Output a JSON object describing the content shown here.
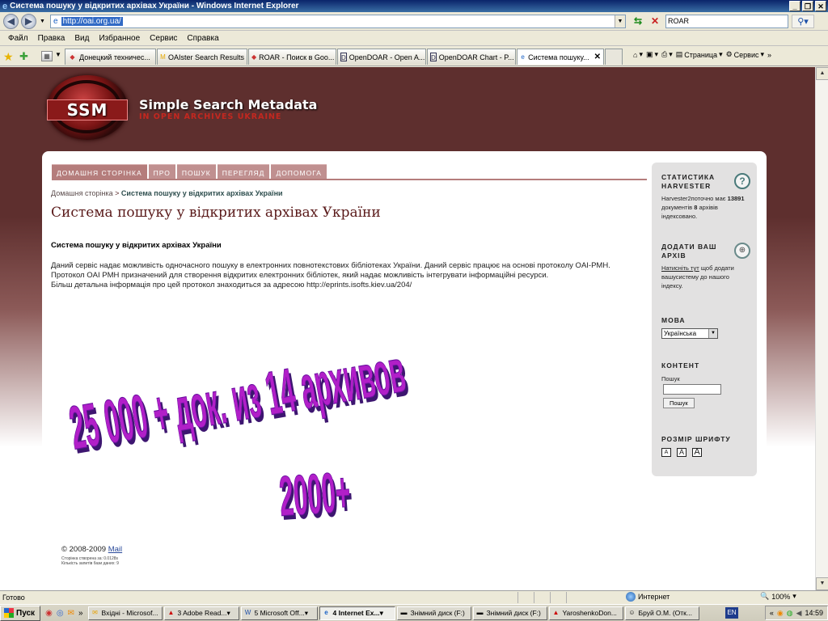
{
  "window": {
    "title": "Система пошуку у відкритих архівах України - Windows Internet Explorer",
    "minimize": "_",
    "maximize": "❐",
    "close": "✕"
  },
  "address": {
    "url": "http://oai.org.ua/",
    "search_value": "ROAR"
  },
  "menu": [
    "Файл",
    "Правка",
    "Вид",
    "Избранное",
    "Сервис",
    "Справка"
  ],
  "tabs": [
    {
      "label": "Донецкий техничес...",
      "icon": "roar-icon"
    },
    {
      "label": "OAIster Search Results",
      "icon": "oaister-icon"
    },
    {
      "label": "ROAR - Поиск в Goo...",
      "icon": "roar-icon"
    },
    {
      "label": "OpenDOAR - Open A...",
      "icon": "opendoar-icon"
    },
    {
      "label": "OpenDOAR Chart - P...",
      "icon": "opendoar-icon"
    },
    {
      "label": "Система пошуку...",
      "icon": "ie-icon",
      "active": true
    }
  ],
  "command_bar": {
    "page_label": "Страница",
    "tools_label": "Сервис"
  },
  "site": {
    "logo_text": "SSM",
    "title": "Simple Search Metadata",
    "subtitle": "IN OPEN ARCHIVES UKRAINE",
    "nav": [
      "ДОМАШНЯ СТОРІНКА",
      "ПРО",
      "ПОШУК",
      "ПЕРЕГЛЯД",
      "ДОПОМОГА"
    ],
    "breadcrumb_home": "Домашня сторінка",
    "breadcrumb_sep": ">",
    "breadcrumb_current": "Система пошуку у відкритих архівах України",
    "heading": "Система пошуку у відкритих архівах України",
    "section_title": "Система пошуку у відкритих архівах України",
    "paragraph": "Даний сервіс надає можливість одночасного пошуку в електронних повнотекстових бібліотеках України. Даний сервіс працює на основі протоколу OAI-PMH. Протокол OAI PMH призначений для створення відкритих електронних бібліотек, який надає можливість інтегрувати інформаційні ресурси.",
    "paragraph2": "Більш детальна інформація про цей протокол знаходиться за адресою http://eprints.isofts.kiev.ua/204/",
    "footer_copy": "© 2008-2009",
    "footer_mail": "Mail",
    "footer_small1": "Сторінка створена за: 0.0128s",
    "footer_small2": "Кількість запитів бази даних: 9"
  },
  "sidebar": {
    "stats_title": "СТАТИСТИКА HARVESTER",
    "stats_text_a": "Harvester2поточно має",
    "stats_docs": "13891",
    "stats_text_b": "документів",
    "stats_archives": "8",
    "stats_text_c": "архівів індексовано.",
    "add_title": "ДОДАТИ ВАШ АРХІВ",
    "add_link": "Натисніть тут",
    "add_text": "щоб додати вашусистему до нашого індексу.",
    "lang_title": "МОВА",
    "lang_value": "Українська",
    "content_title": "КОНТЕНТ",
    "search_label": "Пошук",
    "search_button": "Пошук",
    "font_title": "РОЗМІР ШРИФТУ",
    "font_small": "A",
    "font_medium": "A",
    "font_large": "A"
  },
  "overlay": {
    "line1": "25 000 + док. из 14 архивов",
    "line2": "2000+"
  },
  "status": {
    "text": "Готово",
    "zone": "Интернет",
    "zoom": "100%"
  },
  "taskbar": {
    "start": "Пуск",
    "buttons": [
      {
        "label": "Вхідні - Microsof...",
        "icon": "outlook-icon"
      },
      {
        "label": "3 Adobe Read...",
        "icon": "pdf-icon"
      },
      {
        "label": "5 Microsoft Off...",
        "icon": "word-icon"
      },
      {
        "label": "4 Internet Ex...",
        "icon": "ie-icon",
        "active": true
      },
      {
        "label": "Знімний диск (F:)",
        "icon": "drive-icon"
      },
      {
        "label": "Знімний диск (F:)",
        "icon": "drive-icon"
      },
      {
        "label": "YaroshenkoDon...",
        "icon": "pdf-icon"
      },
      {
        "label": "Бруй О.М. (Отк...",
        "icon": "user-icon"
      }
    ],
    "lang": "EN",
    "clock": "14:59"
  }
}
